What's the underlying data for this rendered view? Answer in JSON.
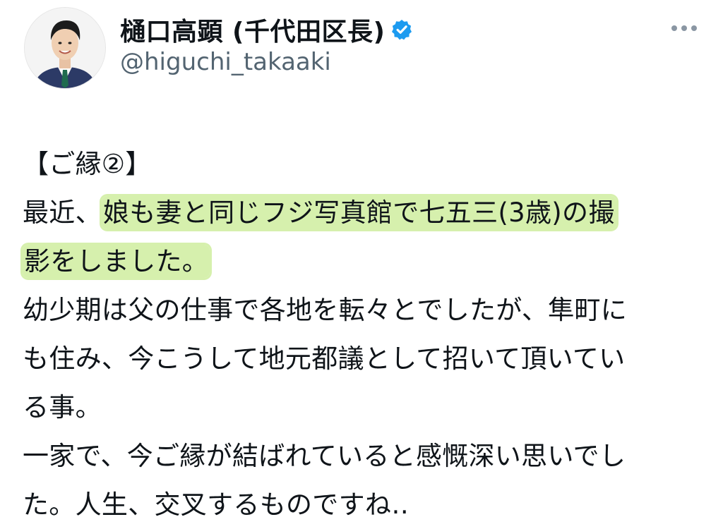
{
  "author": {
    "display_name": "樋口高顕 (千代田区長)",
    "handle": "@higuchi_takaaki",
    "verified_icon": "verified-badge-icon",
    "avatar_icon": "profile-photo"
  },
  "more_icon": "more-options-icon",
  "tweet": {
    "line1": "【ご縁②】",
    "line2_prefix": "最近、",
    "line2_highlight": "娘も妻と同じフジ写真館で七五三(3歳)の撮",
    "line3_highlight": "影をしました。",
    "line4": "幼少期は父の仕事で各地を転々とでしたが、隼町に",
    "line5": "も住み、今こうして地元都議として招いて頂いてい",
    "line6": "る事。",
    "line7": "一家で、今ご縁が結ばれていると感慨深い思いでし",
    "line8": "た。人生、交叉するものですね‥"
  },
  "colors": {
    "highlight": "#d6f0ad",
    "verified": "#1d9bf0",
    "handle": "#536471"
  }
}
